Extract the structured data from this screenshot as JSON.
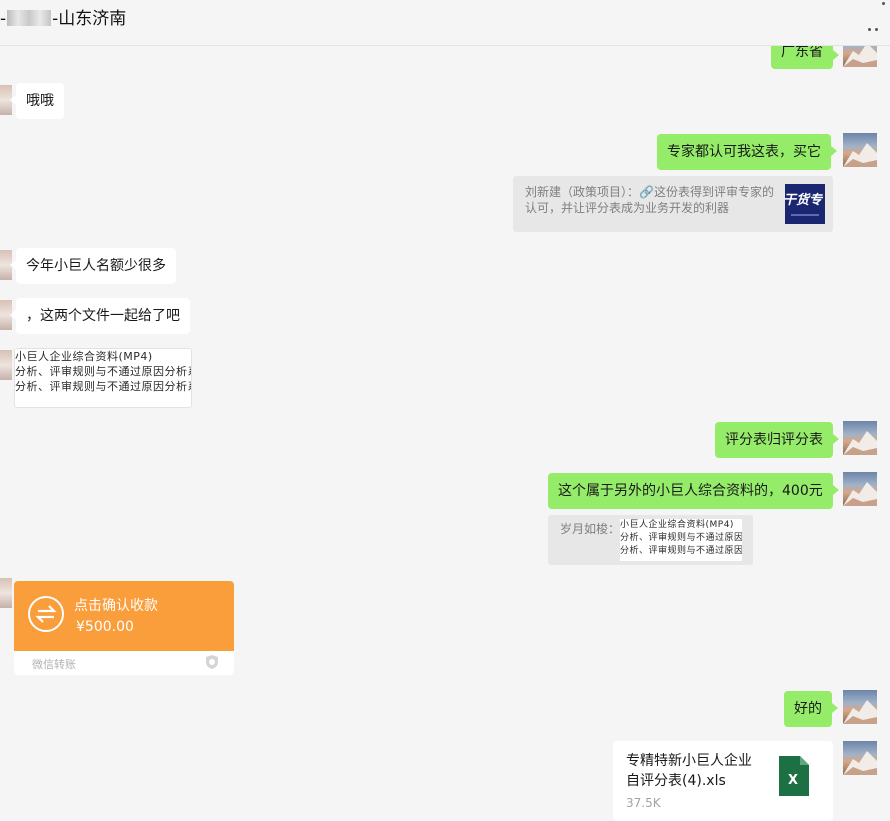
{
  "header": {
    "title_suffix": "-山东济南"
  },
  "messages": {
    "top_partial": "广东省",
    "m1": "哦哦",
    "m2": "专家都认可我这表，买它",
    "quote1_text": "刘新建（政策项目）：🔗这份表得到评审专家的认可，并让评分表成为业务开发的利器",
    "quote1_thumb": "干货专",
    "m3": "今年小巨人名额少很多",
    "m4": "，这两个文件一起给了吧",
    "doc_thumb_lines": [
      "小巨人企业综合资料(MP4)",
      "分析、评审规则与不通过原因分析系统",
      "分析、评审规则与不通过原因分析系统"
    ],
    "m5": "评分表归评分表",
    "m6": "这个属于另外的小巨人综合资料的，400元",
    "quote2_sender": "岁月如梭：",
    "transfer": {
      "title": "点击确认收款",
      "amount": "¥500.00",
      "footer": "微信转账"
    },
    "m7": "好的",
    "file": {
      "name_line1": "专精特新小巨人企业",
      "name_line2": "自评分表(4).xls",
      "size": "37.5K",
      "icon_letter": "X"
    }
  },
  "colors": {
    "out_bubble": "#95ec69",
    "in_bubble": "#ffffff",
    "transfer": "#fa9d3b",
    "excel": "#1d7044"
  }
}
